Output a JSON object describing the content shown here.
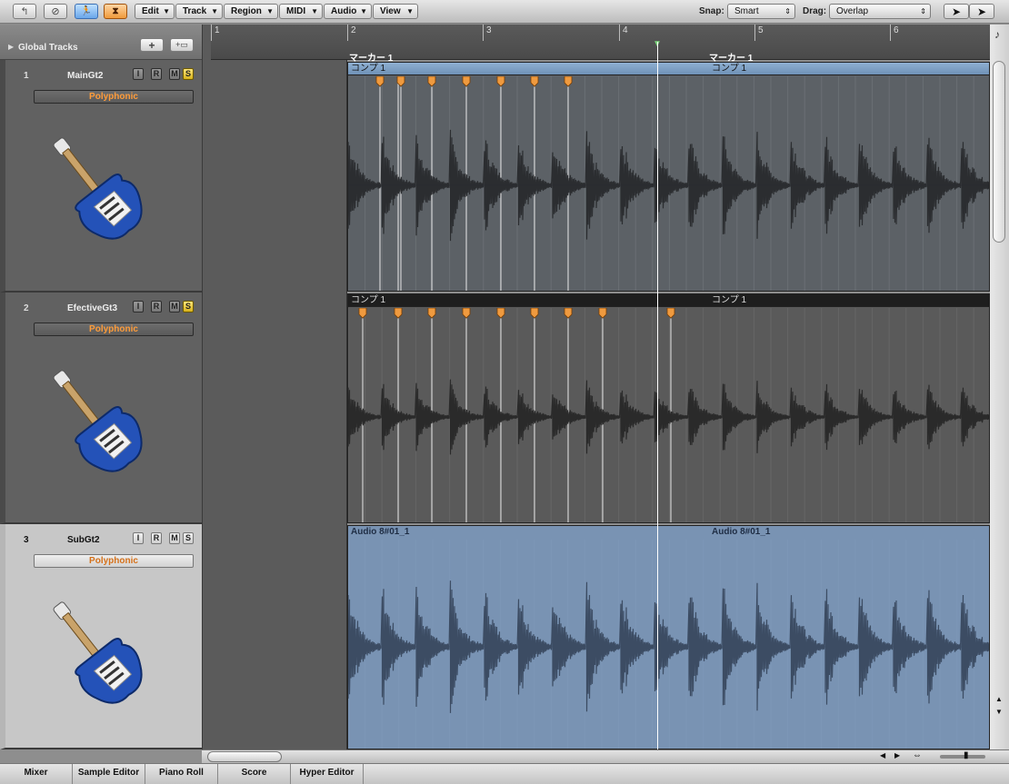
{
  "toolbar": {
    "menus": [
      "Edit",
      "Track",
      "Region",
      "MIDI",
      "Audio",
      "View"
    ],
    "snap_label": "Snap:",
    "snap_value": "Smart",
    "drag_label": "Drag:",
    "drag_value": "Overlap"
  },
  "global_tracks": {
    "label": "Global Tracks"
  },
  "ruler": {
    "bars": [
      "1",
      "2",
      "3",
      "4",
      "5",
      "6"
    ],
    "markers": [
      "マーカー 1",
      "マーカー 1"
    ]
  },
  "tracks": [
    {
      "number": "1",
      "name": "MainGt2",
      "mode": "Polyphonic",
      "buttons": [
        "I",
        "R",
        "M",
        "S"
      ],
      "solo": true,
      "region_label_left": "コンプ 1",
      "region_label_right": "コンプ 1"
    },
    {
      "number": "2",
      "name": "EfectiveGt3",
      "mode": "Polyphonic",
      "buttons": [
        "I",
        "R",
        "M",
        "S"
      ],
      "solo": true,
      "region_label_left": "コンプ 1",
      "region_label_right": "コンプ 1"
    },
    {
      "number": "3",
      "name": "SubGt2",
      "mode": "Polyphonic",
      "buttons": [
        "I",
        "R",
        "M",
        "S"
      ],
      "solo": false,
      "region_label_left": "Audio 8#01_1",
      "region_label_right": "Audio 8#01_1"
    }
  ],
  "tabs": [
    "Mixer",
    "Sample Editor",
    "Piano Roll",
    "Score",
    "Hyper Editor"
  ],
  "colors": {
    "accent_orange": "#ff9c3a",
    "comp_green": "#5fc65f",
    "audio_region_blue": "#7993b3",
    "solo_yellow": "#f0cc3a"
  }
}
